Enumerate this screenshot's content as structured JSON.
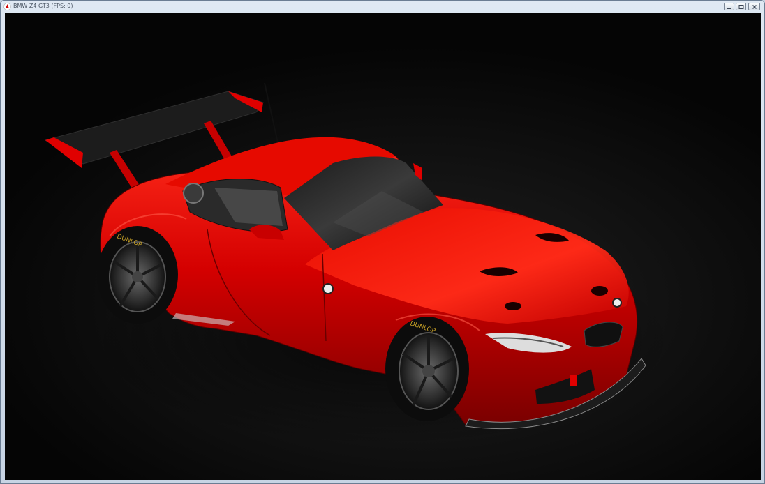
{
  "window": {
    "title": "BMW Z4 GT3 (FPS: 0)",
    "controls": {
      "minimize_icon": "minimize-icon",
      "maximize_icon": "maximize-icon",
      "close_icon": "close-icon"
    }
  },
  "viewport": {
    "background_color": "#0a0a0a",
    "car_color": "#d90000",
    "tire_brand": "DUNLOP"
  }
}
